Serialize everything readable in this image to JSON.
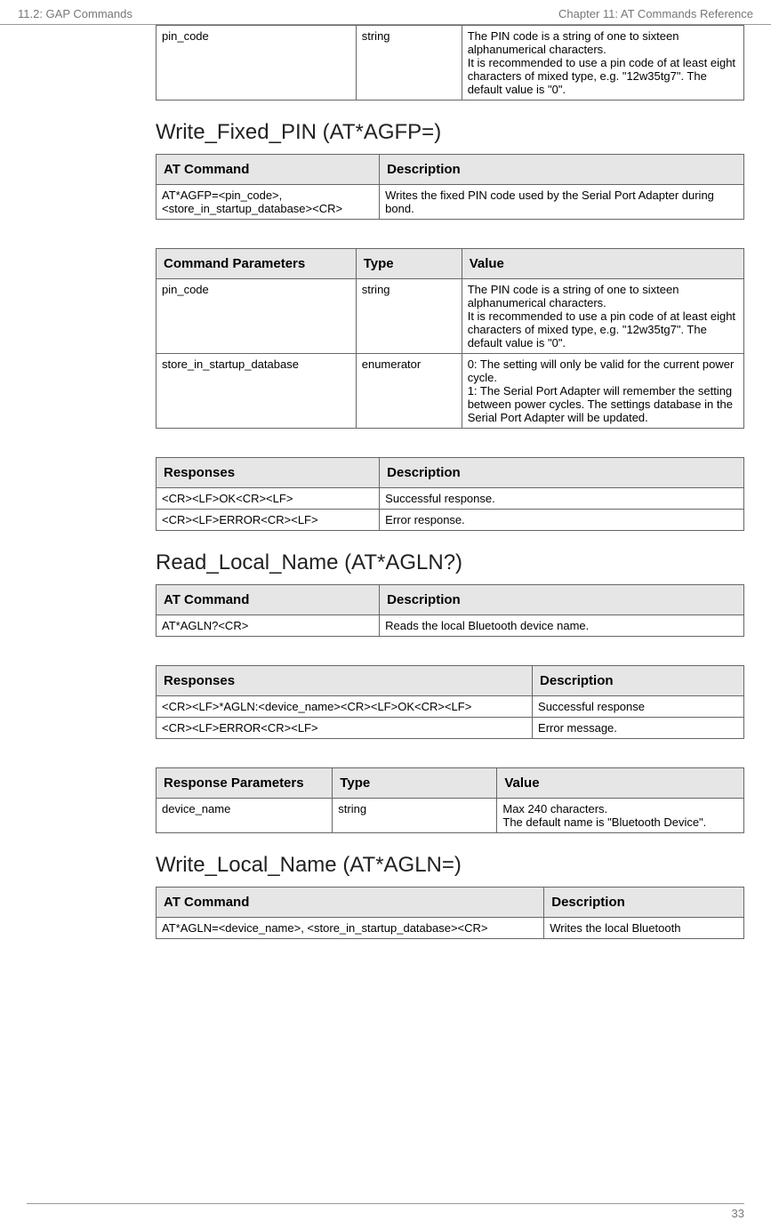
{
  "header": {
    "left": "11.2: GAP Commands",
    "right": "Chapter 11: AT Commands Reference"
  },
  "topTable": {
    "row": {
      "c0": "pin_code",
      "c1": "string",
      "c2": "The PIN code is a string of one to sixteen alphanumerical characters.\nIt is recommended to use a pin code of at least eight characters of mixed type, e.g. \"12w35tg7\". The default value is \"0\"."
    }
  },
  "sections": {
    "writeFixedPin": {
      "title": "Write_Fixed_PIN (AT*AGFP=)",
      "atTable": {
        "h0": "AT Command",
        "h1": "Description",
        "r0c0": "AT*AGFP=<pin_code>, <store_in_startup_database><CR>",
        "r0c1": "Writes the fixed PIN code used by the Serial Port Adapter during bond."
      },
      "paramsTable": {
        "h0": "Command Parameters",
        "h1": "Type",
        "h2": "Value",
        "r0c0": "pin_code",
        "r0c1": "string",
        "r0c2": "The PIN code is a string of one to sixteen alphanumerical characters.\nIt is recommended to use a pin code of at least eight characters of mixed type, e.g. \"12w35tg7\". The default value is \"0\".",
        "r1c0": "store_in_startup_database",
        "r1c1": "enumerator",
        "r1c2": "0: The setting will only be valid for the current power cycle.\n1: The Serial Port Adapter will remember the setting between power cycles. The settings database in the Serial Port Adapter will be updated."
      },
      "respTable": {
        "h0": "Responses",
        "h1": "Description",
        "r0c0": "<CR><LF>OK<CR><LF>",
        "r0c1": "Successful response.",
        "r1c0": "<CR><LF>ERROR<CR><LF>",
        "r1c1": "Error response."
      }
    },
    "readLocalName": {
      "title": "Read_Local_Name (AT*AGLN?)",
      "atTable": {
        "h0": "AT Command",
        "h1": "Description",
        "r0c0": "AT*AGLN?<CR>",
        "r0c1": "Reads the local Bluetooth device name."
      },
      "respTable": {
        "h0": "Responses",
        "h1": "Description",
        "r0c0": "<CR><LF>*AGLN:<device_name><CR><LF>OK<CR><LF>",
        "r0c1": "Successful response",
        "r1c0": "<CR><LF>ERROR<CR><LF>",
        "r1c1": "Error message."
      },
      "respParams": {
        "h0": "Response Parameters",
        "h1": "Type",
        "h2": "Value",
        "r0c0": "device_name",
        "r0c1": "string",
        "r0c2": "Max 240 characters.\nThe default name is \"Bluetooth Device\"."
      }
    },
    "writeLocalName": {
      "title": "Write_Local_Name (AT*AGLN=)",
      "atTable": {
        "h0": "AT Command",
        "h1": "Description",
        "r0c0": "AT*AGLN=<device_name>, <store_in_startup_database><CR>",
        "r0c1": "Writes the local Bluetooth"
      }
    }
  },
  "footer": {
    "page": "33"
  }
}
